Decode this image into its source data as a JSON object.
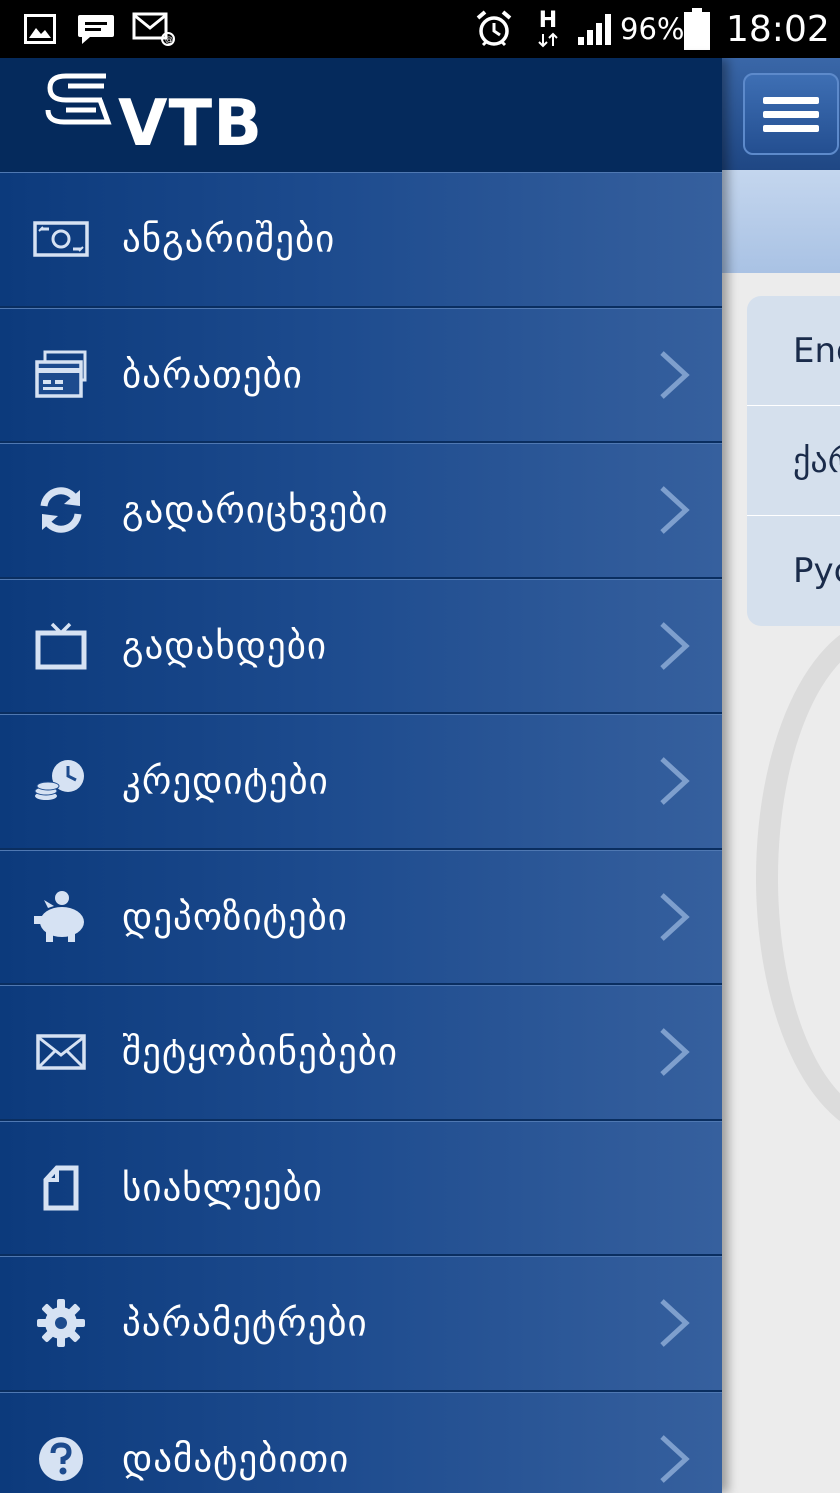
{
  "status_bar": {
    "battery": "96%",
    "time": "18:02",
    "network": "H"
  },
  "brand": {
    "name": "VTB"
  },
  "menu": {
    "items": [
      {
        "label": "ანგარიშები",
        "icon": "money-icon",
        "chevron": false
      },
      {
        "label": "ბარათები",
        "icon": "cards-icon",
        "chevron": true
      },
      {
        "label": "გადარიცხვები",
        "icon": "refresh-icon",
        "chevron": true
      },
      {
        "label": "გადახდები",
        "icon": "tv-icon",
        "chevron": true
      },
      {
        "label": "კრედიტები",
        "icon": "coins-clock-icon",
        "chevron": true
      },
      {
        "label": "დეპოზიტები",
        "icon": "piggy-bank-icon",
        "chevron": true
      },
      {
        "label": "შეტყობინებები",
        "icon": "envelope-icon",
        "chevron": true
      },
      {
        "label": "სიახლეები",
        "icon": "document-icon",
        "chevron": false
      },
      {
        "label": "პარამეტრები",
        "icon": "gear-icon",
        "chevron": true
      },
      {
        "label": "დამატებითი",
        "icon": "help-icon",
        "chevron": true
      }
    ]
  },
  "languages": {
    "items": [
      "Eng",
      "ქარ",
      "Рус"
    ]
  },
  "colors": {
    "drawer_bg": "#0e3a78",
    "header_bg": "#052a5c",
    "accent": "#3a67a8"
  }
}
